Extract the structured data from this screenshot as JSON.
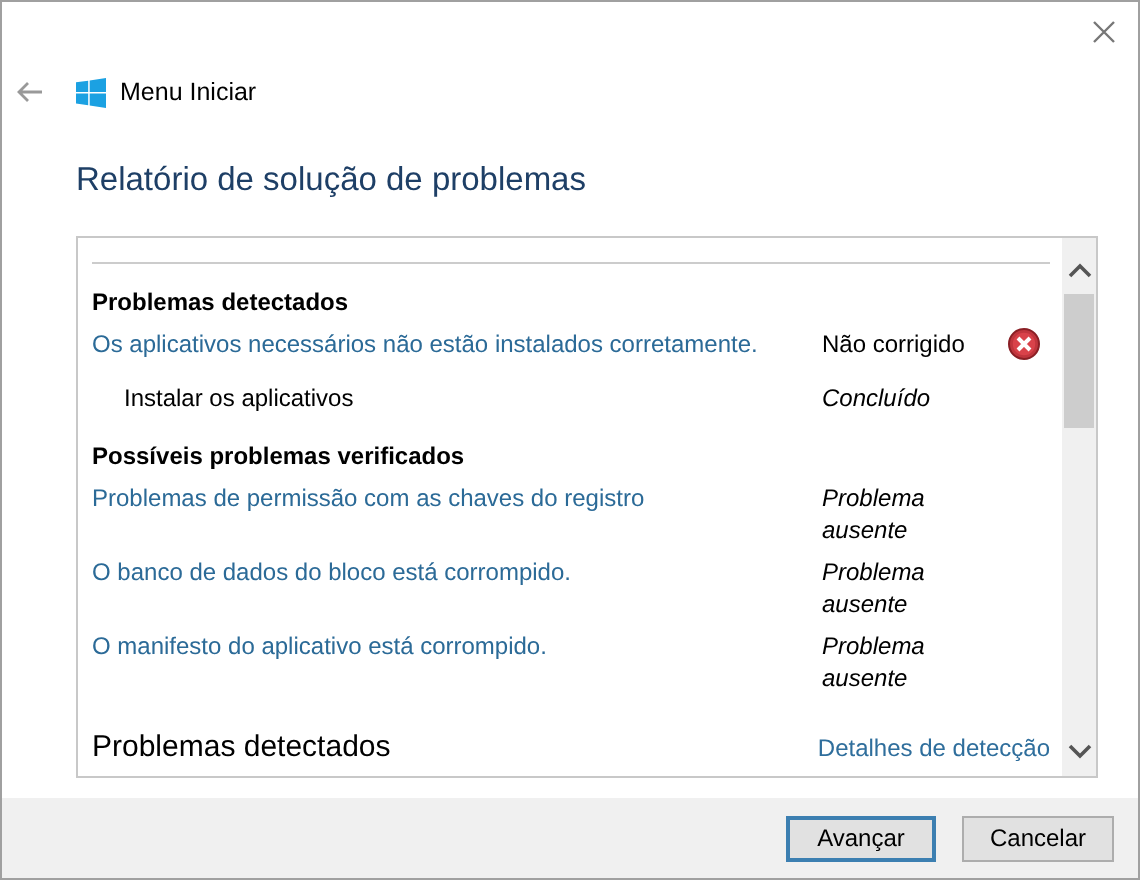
{
  "header": {
    "title": "Menu Iniciar"
  },
  "page_title": "Relatório de solução de problemas",
  "report": [
    {
      "kind": "group",
      "title": "Problemas detectados",
      "items": [
        {
          "kind": "problem",
          "text": "Os aplicativos necessários não estão instalados corretamente.",
          "status": "Não corrigido",
          "fixed": false,
          "children": [
            {
              "text": "Instalar os aplicativos",
              "status": "Concluído"
            }
          ]
        }
      ]
    },
    {
      "kind": "group",
      "title": "Possíveis problemas verificados",
      "items": [
        {
          "kind": "check",
          "text": "Problemas de permissão com as chaves do registro",
          "status": "Problema ausente"
        },
        {
          "kind": "check",
          "text": "O banco de dados do bloco está corrompido.",
          "status": "Problema ausente"
        },
        {
          "kind": "check",
          "text": "O manifesto do aplicativo está corrompido.",
          "status": "Problema ausente"
        }
      ]
    },
    {
      "kind": "banner",
      "title": "Problemas detectados",
      "link": "Detalhes de detecção"
    }
  ],
  "buttons": [
    {
      "label": "Avançar",
      "default": true
    },
    {
      "label": "Cancelar",
      "default": false
    }
  ]
}
